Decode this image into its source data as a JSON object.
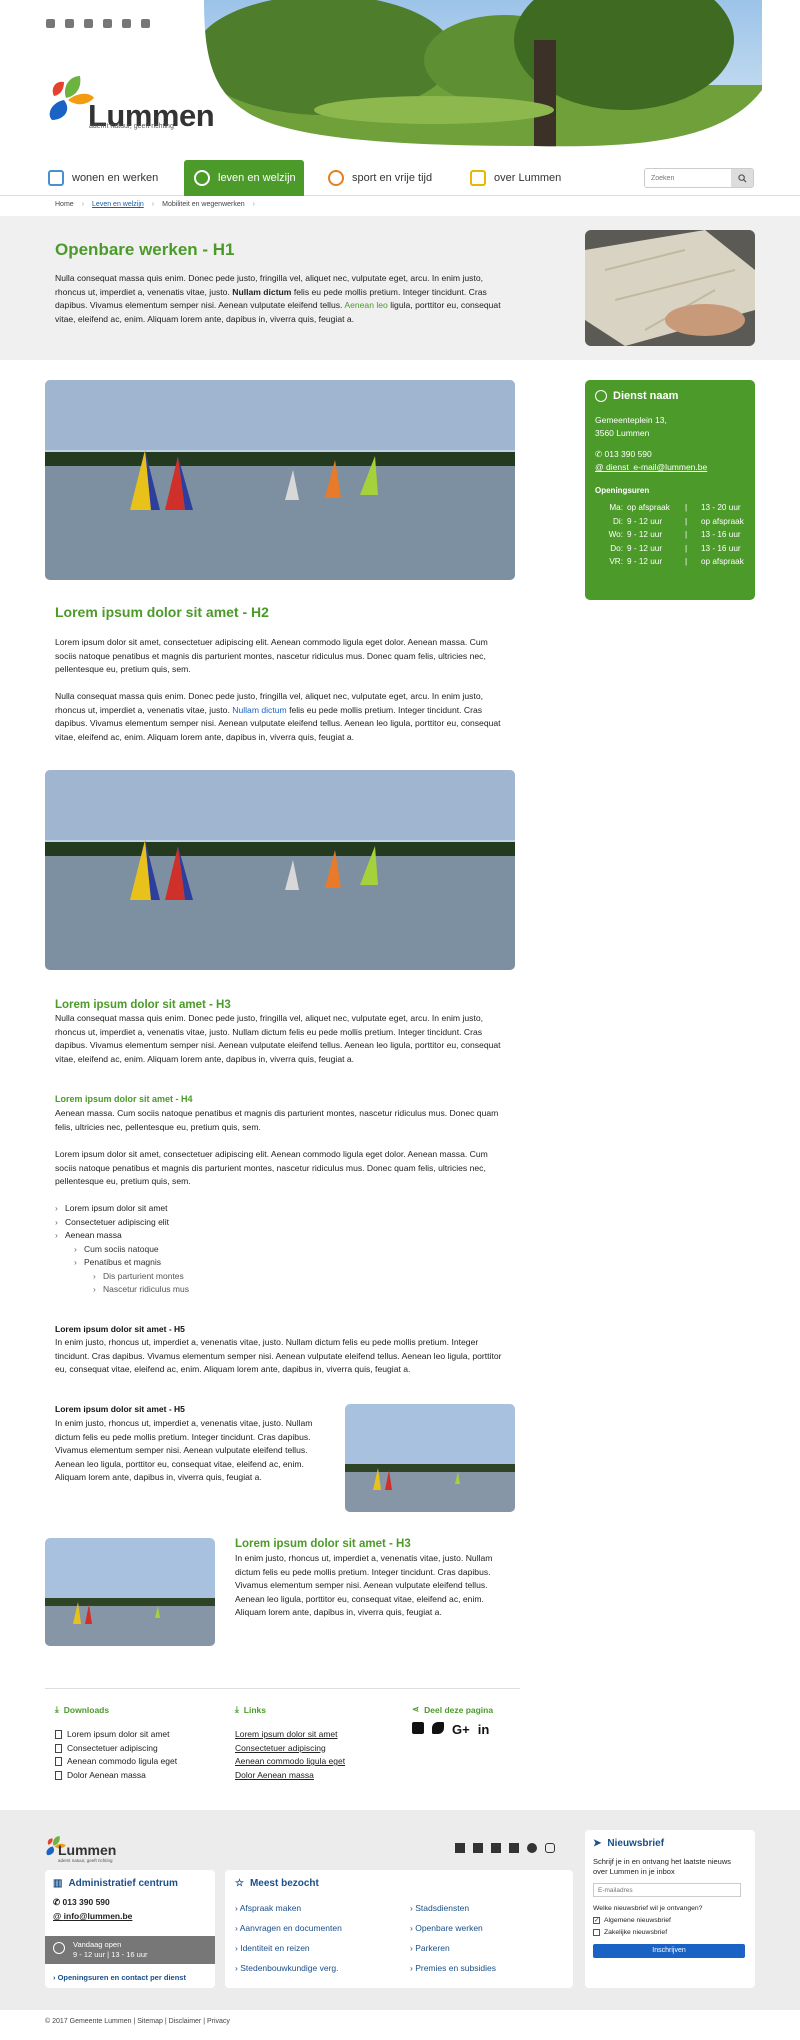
{
  "header": {
    "social": [
      "facebook-icon",
      "twitter-icon",
      "youtube-icon",
      "linkedin-icon",
      "whatsapp-icon",
      "instagram-icon"
    ],
    "logo_text": "Lummen",
    "logo_tagline": "ademt natuur, geeft richting"
  },
  "nav": {
    "items": [
      {
        "label": "wonen en werken",
        "icon": "building-icon"
      },
      {
        "label": "leven en welzijn",
        "icon": "heart-icon",
        "active": true
      },
      {
        "label": "sport en vrije tijd",
        "icon": "ball-icon"
      },
      {
        "label": "over Lummen",
        "icon": "townhall-icon"
      }
    ],
    "search_placeholder": "Zoeken"
  },
  "breadcrumb": [
    "Home",
    "Leven en welzijn",
    "Mobiliteit en wegenwerken"
  ],
  "page": {
    "title": "Openbare werken - H1",
    "intro_a": "Nulla consequat massa quis enim. Donec pede justo, fringilla vel, aliquet nec, vulputate eget, arcu. In enim justo, rhoncus ut, imperdiet a, venenatis vitae, justo. ",
    "intro_bold": "Nullam dictum",
    "intro_b": " felis eu pede mollis pretium. Integer tincidunt. Cras dapibus. Vivamus elementum semper nisi. Aenean vulputate eleifend tellus. ",
    "intro_link": "Aenean leo",
    "intro_c": " ligula, porttitor eu, consequat vitae, eleifend ac, enim. Aliquam lorem ante, dapibus in, viverra quis, feugiat a."
  },
  "service": {
    "title": "Dienst naam",
    "address_1": "Gemeenteplein 13,",
    "address_2": "3560 Lummen",
    "phone": "013 390 590",
    "email": "dienst_e-mail@lummen.be",
    "hours_title": "Openingsuren",
    "hours": [
      [
        "Ma:",
        "op afspraak",
        "|",
        "13 - 20 uur"
      ],
      [
        "Di:",
        "9 - 12 uur",
        "|",
        "op afspraak"
      ],
      [
        "Wo:",
        "9 - 12 uur",
        "|",
        "13 - 16 uur"
      ],
      [
        "Do:",
        "9 - 12 uur",
        "|",
        "13 - 16 uur"
      ],
      [
        "VR:",
        "9 - 12 uur",
        "|",
        "op afspraak"
      ]
    ]
  },
  "content": {
    "h2": "Lorem ipsum dolor sit amet - H2",
    "p1": "Lorem ipsum dolor sit amet, consectetuer adipiscing elit. Aenean commodo ligula eget dolor. Aenean massa. Cum sociis natoque penatibus et magnis dis parturient montes, nascetur ridiculus mus. Donec quam felis, ultricies nec, pellentesque eu, pretium quis, sem.",
    "p2_a": "Nulla consequat massa quis enim. Donec pede justo, fringilla vel, aliquet nec, vulputate eget, arcu. In enim justo, rhoncus ut, imperdiet a, venenatis vitae, justo. ",
    "p2_link": "Nullam dictum",
    "p2_b": " felis eu pede mollis pretium. Integer tincidunt. Cras dapibus. Vivamus elementum semper nisi. Aenean vulputate eleifend tellus. Aenean leo ligula, porttitor eu, consequat vitae, eleifend ac, enim. Aliquam lorem ante, dapibus in, viverra quis, feugiat a.",
    "h3": "Lorem ipsum dolor sit amet - H3",
    "p3": "Nulla consequat massa quis enim. Donec pede justo, fringilla vel, aliquet nec, vulputate eget, arcu. In enim justo, rhoncus ut, imperdiet a, venenatis vitae, justo. Nullam dictum felis eu pede mollis pretium. Integer tincidunt. Cras dapibus. Vivamus elementum semper nisi. Aenean vulputate eleifend tellus. Aenean leo ligula, porttitor eu, consequat vitae, eleifend ac, enim. Aliquam lorem ante, dapibus in, viverra quis, feugiat a.",
    "h4": "Lorem ipsum dolor sit amet - H4",
    "p4": "Aenean massa. Cum sociis natoque penatibus et magnis dis parturient montes, nascetur ridiculus mus. Donec quam felis, ultricies nec, pellentesque eu, pretium quis, sem.",
    "p5": "Lorem ipsum dolor sit amet, consectetuer adipiscing elit. Aenean commodo ligula eget dolor. Aenean massa. Cum sociis natoque penatibus et magnis dis parturient montes, nascetur ridiculus mus. Donec quam felis, ultricies nec, pellentesque eu, pretium quis, sem.",
    "list": [
      {
        "t": "Lorem ipsum dolor sit amet",
        "l": 1
      },
      {
        "t": "Consectetuer adipiscing elit",
        "l": 1
      },
      {
        "t": "Aenean massa",
        "l": 1
      },
      {
        "t": "Cum sociis natoque",
        "l": 2
      },
      {
        "t": "Penatibus et magnis",
        "l": 2
      },
      {
        "t": "Dis parturient montes",
        "l": 3
      },
      {
        "t": "Nascetur ridiculus mus",
        "l": 3
      }
    ],
    "h5": "Lorem ipsum dolor sit amet - H5",
    "p6": "In enim justo, rhoncus ut, imperdiet a, venenatis vitae, justo. Nullam dictum felis eu pede mollis pretium. Integer tincidunt. Cras dapibus. Vivamus elementum semper nisi. Aenean vulputate eleifend tellus. Aenean leo ligula, porttitor eu, consequat vitae, eleifend ac, enim. Aliquam lorem ante, dapibus in, viverra quis, feugiat a.",
    "h5b": "Lorem ipsum dolor sit amet - H5",
    "p7": "In enim justo, rhoncus ut, imperdiet a, venenatis vitae, justo. Nullam dictum felis eu pede mollis pretium. Integer tincidunt. Cras dapibus. Vivamus elementum semper nisi. Aenean vulputate eleifend tellus. Aenean leo ligula, porttitor eu, consequat vitae, eleifend ac, enim. Aliquam lorem ante, dapibus in, viverra quis, feugiat a.",
    "h3b": "Lorem ipsum dolor sit amet - H3",
    "p8": "In enim justo, rhoncus ut, imperdiet a, venenatis vitae, justo. Nullam dictum felis eu pede mollis pretium. Integer tincidunt. Cras dapibus. Vivamus elementum semper nisi. Aenean vulputate eleifend tellus. Aenean leo ligula, porttitor eu, consequat vitae, eleifend ac, enim. Aliquam lorem ante, dapibus in, viverra quis, feugiat a."
  },
  "downloads": {
    "title": "Downloads",
    "items": [
      "Lorem ipsum dolor sit amet",
      "Consectetuer adipiscing",
      "Aenean commodo ligula eget",
      "Dolor Aenean massa"
    ]
  },
  "links": {
    "title": "Links",
    "items": [
      "Lorem ipsum dolor sit amet",
      "Consectetuer adipiscing",
      "Aenean commodo ligula eget",
      "Dolor Aenean massa"
    ]
  },
  "share": {
    "title": "Deel deze pagina",
    "icons": [
      "facebook-icon",
      "twitter-icon",
      "G+",
      "in"
    ]
  },
  "footer": {
    "logo_text": "Lummen",
    "logo_tagline": "ademt natuur, geeft richting",
    "admin_title": "Administratief centrum",
    "phone": "013 390 590",
    "email": "info@lummen.be",
    "open_1": "Vandaag open",
    "open_2": "9 - 12 uur | 13 - 16 uur",
    "contact_link": "Openingsuren en contact per dienst",
    "visited_title": "Meest bezocht",
    "visited_col1": [
      "Afspraak maken",
      "Aanvragen en documenten",
      "Identiteit en reizen",
      "Stedenbouwkundige verg."
    ],
    "visited_col2": [
      "Stadsdiensten",
      "Openbare werken",
      "Parkeren",
      "Premies en subsidies"
    ],
    "news_title": "Nieuwsbrief",
    "news_text": "Schrijf je in en ontvang het laatste nieuws over Lummen in je inbox",
    "news_placeholder": "E-mailadres",
    "news_question": "Welke nieuwsbrief wil je ontvangen?",
    "news_opt1": "Algemene nieuwsbrief",
    "news_opt2": "Zakelijke nieuwsbrief",
    "news_button": "Inschrijven",
    "copyright": "© 2017 Gemeente Lummen | Sitemap | Disclaimer | Privacy"
  }
}
